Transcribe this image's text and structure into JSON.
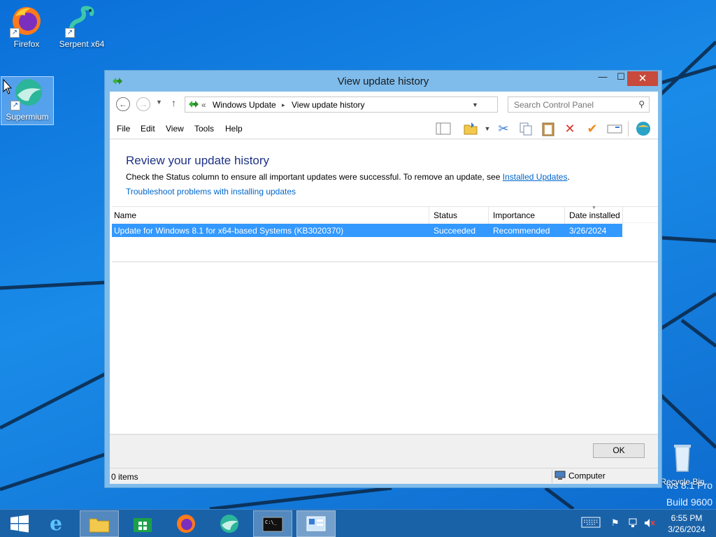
{
  "desktop": {
    "icons": [
      {
        "label": "Firefox"
      },
      {
        "label": "Serpent x64"
      },
      {
        "label": "Supermium"
      },
      {
        "label": "Recycle Bin"
      }
    ],
    "watermark": {
      "line1": "ws 8.1 Pro",
      "line2": "Build 9600"
    }
  },
  "window": {
    "title": "View update history",
    "controls": {
      "minimize": "—",
      "maximize": "☐",
      "close": "✕"
    },
    "address": {
      "prefix": "«",
      "crumbs": [
        "Windows Update",
        "View update history"
      ],
      "separator": "▸"
    },
    "search": {
      "placeholder": "Search Control Panel"
    },
    "menu": [
      "File",
      "Edit",
      "View",
      "Tools",
      "Help"
    ],
    "heading": "Review your update history",
    "description": {
      "text": "Check the Status column to ensure all important updates were successful. To remove an update, see",
      "link": "Installed Updates",
      "end": "."
    },
    "troubleshoot_link": "Troubleshoot problems with installing updates",
    "table": {
      "columns": [
        "Name",
        "Status",
        "Importance",
        "Date installed"
      ],
      "rows": [
        {
          "name": "Update for Windows 8.1 for x64-based Systems (KB3020370)",
          "status": "Succeeded",
          "importance": "Recommended",
          "date": "3/26/2024"
        }
      ]
    },
    "ok_label": "OK",
    "status": {
      "items": "0 items",
      "zone": "Computer"
    }
  },
  "taskbar": {
    "apps": [
      "start-button",
      "internet-explorer",
      "file-explorer",
      "store",
      "firefox",
      "supermium",
      "command-prompt",
      "control-panel"
    ],
    "clock": {
      "time": "6:55 PM",
      "date": "3/26/2024"
    }
  },
  "colors": {
    "selection": "#3399ff",
    "heading": "#1e3287",
    "link": "#0066cc",
    "close": "#c74a3c",
    "taskbar": "#1a62a8"
  }
}
